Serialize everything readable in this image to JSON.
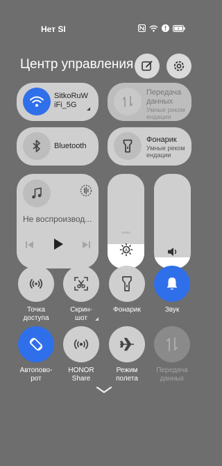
{
  "status": {
    "carrier": "Нет SI"
  },
  "header": {
    "title": "Центр управления"
  },
  "tiles": {
    "wifi": {
      "name_line1": "SitkoRuW",
      "name_line2": "iFi_5G"
    },
    "bluetooth": {
      "label": "Bluetooth"
    },
    "data": {
      "title": "Передача",
      "title2": "данных",
      "sub1": "Умные реком",
      "sub2": "ендации"
    },
    "flashlight": {
      "title": "Фонарик",
      "sub1": "Умные реком",
      "sub2": "ендации"
    },
    "media": {
      "status": "Не воспроизвод..."
    }
  },
  "sliders": {
    "brightness_level": 0.26,
    "volume_level": 0.12
  },
  "quick_row1": [
    {
      "line1": "Точка",
      "line2": "доступа"
    },
    {
      "line1": "Скрин-",
      "line2": "шот"
    },
    {
      "line1": "Фонарик",
      "line2": ""
    },
    {
      "line1": "Звук",
      "line2": ""
    }
  ],
  "quick_row2": [
    {
      "line1": "Автопово-",
      "line2": "рот"
    },
    {
      "line1": "HONOR",
      "line2": "Share"
    },
    {
      "line1": "Режим",
      "line2": "полета"
    },
    {
      "line1": "Передача",
      "line2": "данных"
    }
  ],
  "colors": {
    "accent": "#2f6fe9",
    "tile": "#cfcfcf",
    "background": "#6e6e6e"
  }
}
